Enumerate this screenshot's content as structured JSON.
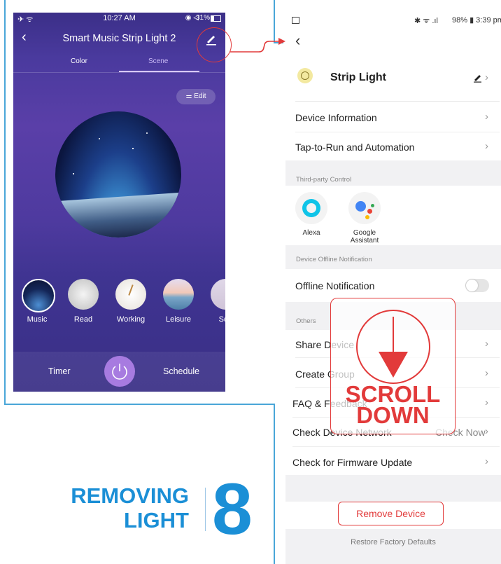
{
  "left_phone": {
    "status_time": "10:27 AM",
    "status_battery": "31%",
    "title": "Smart Music Strip Light 2",
    "tabs": [
      "Color",
      "Scene"
    ],
    "edit_label": "Edit",
    "scenes": [
      "Music",
      "Read",
      "Working",
      "Leisure",
      "Sc"
    ],
    "timer_label": "Timer",
    "schedule_label": "Schedule"
  },
  "right_phone": {
    "status_right": "98% ▮ 3:39 pm",
    "device_name": "Strip Light",
    "rows_top": [
      {
        "label": "Device Information"
      },
      {
        "label": "Tap-to-Run and Automation"
      }
    ],
    "third_party_label": "Third-party Control",
    "third_party": [
      {
        "label": "Alexa"
      },
      {
        "label": "Google\nAssistant"
      }
    ],
    "offline_section_label": "Device Offline Notification",
    "offline_label": "Offline Notification",
    "others_label": "Others",
    "rows_others": [
      {
        "label": "Share Device",
        "right": ""
      },
      {
        "label": "Create Group",
        "right": ""
      },
      {
        "label": "FAQ & Feedback",
        "right": ""
      },
      {
        "label": "Check Device Network",
        "right": "Check Now"
      },
      {
        "label": "Check for Firmware Update",
        "right": ""
      }
    ],
    "remove_label": "Remove Device",
    "restore_label": "Restore Factory Defaults"
  },
  "overlay": {
    "scroll_line1": "SCROLL",
    "scroll_line2": "DOWN"
  },
  "caption": {
    "line1": "REMOVING",
    "line2": "LIGHT",
    "step": "8"
  },
  "colors": {
    "accent_red": "#e23a3a",
    "caption_blue": "#1b8fd6",
    "frame_blue": "#4aa6d8",
    "power_purple": "#a77be0"
  }
}
